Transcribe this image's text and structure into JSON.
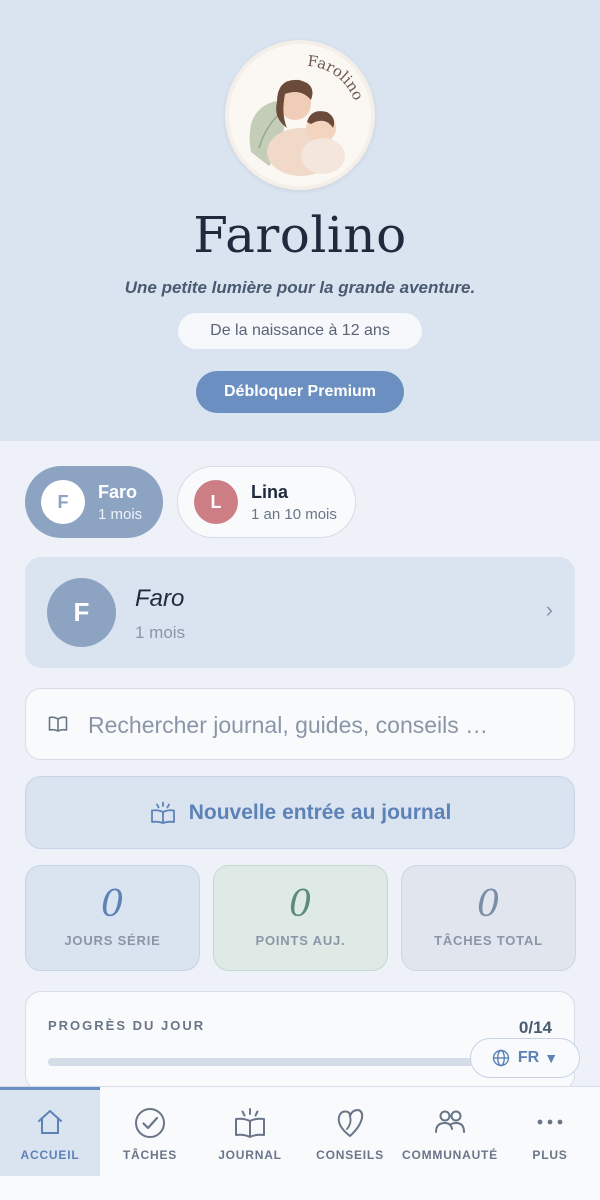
{
  "app": {
    "title": "Farolino",
    "logo_text": "Farolino",
    "tagline": "Une petite lumière pour la grande aventure.",
    "age_range": "De la naissance à 12 ans",
    "premium_button": "Débloquer Premium"
  },
  "children": [
    {
      "initial": "F",
      "name": "Faro",
      "age": "1 mois",
      "selected": true,
      "color": "#8da3c2"
    },
    {
      "initial": "L",
      "name": "Lina",
      "age": "1 an 10 mois",
      "selected": false,
      "color": "#cc7e84"
    }
  ],
  "profile": {
    "initial": "F",
    "name": "Faro",
    "age": "1 mois",
    "chevron": "›"
  },
  "search": {
    "placeholder": "Rechercher journal, guides, conseils …",
    "icon": "book-icon"
  },
  "new_entry": {
    "label": "Nouvelle entrée au journal",
    "icon": "journal-icon"
  },
  "stats": [
    {
      "value": "0",
      "label": "JOURS SÉRIE"
    },
    {
      "value": "0",
      "label": "POINTS AUJ."
    },
    {
      "value": "0",
      "label": "TÂCHES TOTAL"
    }
  ],
  "progress": {
    "title": "PROGRÈS DU JOUR",
    "count": "0/14",
    "done": 0,
    "total": 14
  },
  "language": {
    "label": "FR",
    "caret": "▼",
    "icon": "globe-icon"
  },
  "nav": [
    {
      "label": "ACCUEIL",
      "icon": "home-icon",
      "active": true
    },
    {
      "label": "TÂCHES",
      "icon": "check-circle-icon",
      "active": false
    },
    {
      "label": "JOURNAL",
      "icon": "journal-icon",
      "active": false
    },
    {
      "label": "CONSEILS",
      "icon": "heart-leaf-icon",
      "active": false
    },
    {
      "label": "COMMUNAUTÉ",
      "icon": "people-icon",
      "active": false
    },
    {
      "label": "PLUS",
      "icon": "more-icon",
      "active": false
    }
  ],
  "colors": {
    "accent": "#6b8fc1",
    "hero_bg": "#dae3f0",
    "page_bg": "#eef2f8",
    "points_green": "#5d8d77"
  }
}
